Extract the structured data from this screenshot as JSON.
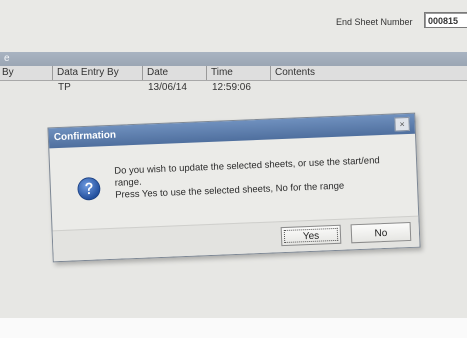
{
  "top_panel": {
    "end_sheet_label": "End Sheet Number",
    "end_sheet_value": "000815"
  },
  "title_strip": {
    "text": "e"
  },
  "grid": {
    "columns": [
      "By",
      "Data Entry By",
      "Date",
      "Time",
      "Contents"
    ],
    "rows": [
      [
        "",
        "TP",
        "13/06/14",
        "12:59:06",
        ""
      ]
    ]
  },
  "dialog": {
    "title": "Confirmation",
    "close_glyph": "×",
    "icon": "question-icon",
    "message_line1": "Do you wish to update the selected sheets, or use the start/end",
    "message_line2": "range.",
    "message_line3": "Press Yes to use the selected sheets, No for the range",
    "yes_label": "Yes",
    "no_label": "No"
  },
  "colors": {
    "title_bar": "#5b7cab",
    "icon_blue": "#2f5fae",
    "panel": "#e9e9e6"
  }
}
